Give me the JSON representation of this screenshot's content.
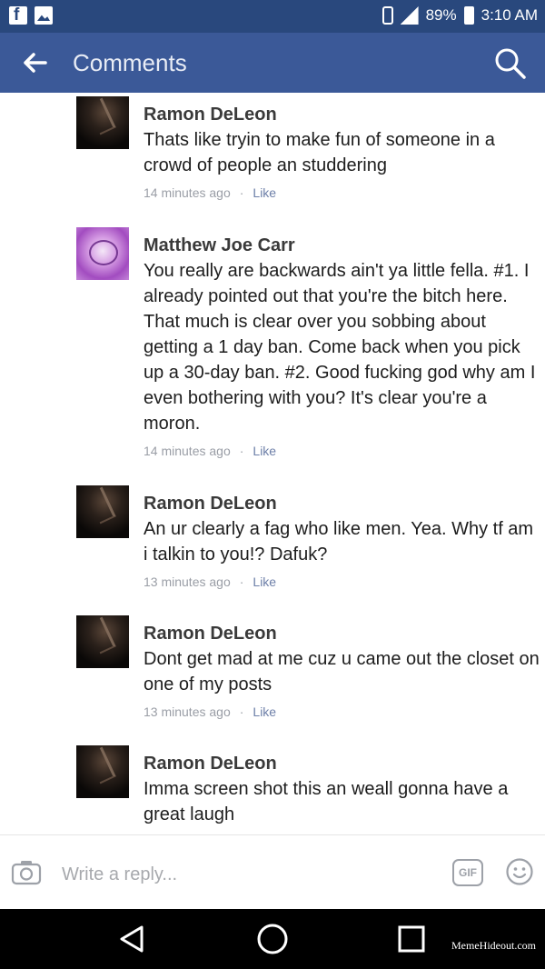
{
  "status_bar": {
    "battery_percent": "89%",
    "time": "3:10 AM",
    "icons": [
      "facebook-notification-icon",
      "image-notification-icon",
      "vibrate-icon",
      "signal-icon",
      "battery-icon"
    ]
  },
  "header": {
    "title": "Comments",
    "icons": [
      "back-arrow-icon",
      "search-icon"
    ],
    "color": "#3b5998"
  },
  "comments": [
    {
      "author": "Ramon DeLeon",
      "text": "Thats like tryin to make fun of someone in a crowd of people an studdering",
      "time": "14 minutes ago",
      "separator": "·",
      "like_label": "Like"
    },
    {
      "author": "Matthew Joe Carr",
      "text": "You really are backwards ain't ya little fella. #1. I already pointed out that you're the bitch here. That much is clear over you sobbing about getting a 1 day ban. Come back when you pick up a 30-day ban. #2. Good fucking god why am I even bothering with you? It's clear you're a moron.",
      "time": "14 minutes ago",
      "separator": "·",
      "like_label": "Like"
    },
    {
      "author": "Ramon DeLeon",
      "text": "An ur clearly a fag who like men. Yea. Why tf am i talkin to you!? Dafuk?",
      "time": "13 minutes ago",
      "separator": "·",
      "like_label": "Like"
    },
    {
      "author": "Ramon DeLeon",
      "text": "Dont get mad at me cuz u came out the closet on one of my posts",
      "time": "13 minutes ago",
      "separator": "·",
      "like_label": "Like"
    },
    {
      "author": "Ramon DeLeon",
      "text": "Imma screen shot this an weall gonna have a great laugh",
      "time": "",
      "separator": "",
      "like_label": ""
    }
  ],
  "reply_bar": {
    "placeholder": "Write a reply...",
    "gif_label": "GIF",
    "icons": [
      "camera-icon",
      "gif-icon",
      "emoji-icon"
    ]
  },
  "nav_bar": {
    "icons": [
      "nav-back-icon",
      "nav-home-icon",
      "nav-recent-apps-icon"
    ]
  },
  "watermark": "MemeHideout.com"
}
